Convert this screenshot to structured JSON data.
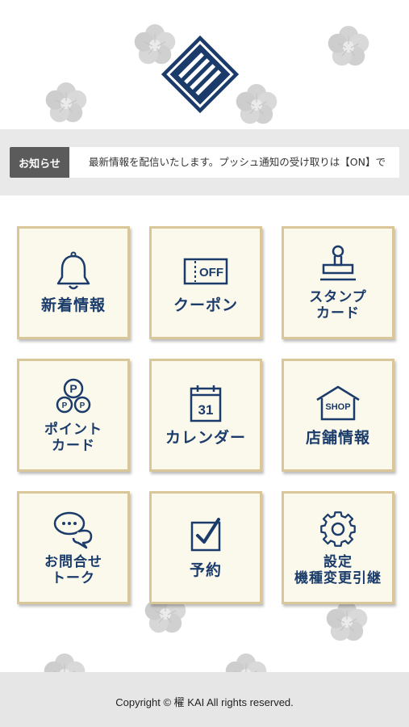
{
  "news": {
    "label": "お知らせ",
    "text": "最新情報を配信いたします。プッシュ通知の受け取りは【ON】で"
  },
  "menu": [
    {
      "label": "新着情報",
      "icon": "bell-icon"
    },
    {
      "label": "クーポン",
      "icon": "coupon-off-icon",
      "icon_text": "OFF"
    },
    {
      "label": "スタンプ\nカード",
      "icon": "stamp-icon"
    },
    {
      "label": "ポイント\nカード",
      "icon": "point-coins-icon",
      "icon_text": "P"
    },
    {
      "label": "カレンダー",
      "icon": "calendar-icon",
      "icon_text": "31"
    },
    {
      "label": "店舗情報",
      "icon": "shop-icon",
      "icon_text": "SHOP"
    },
    {
      "label": "お問合せ\nトーク",
      "icon": "chat-bubbles-icon"
    },
    {
      "label": "予約",
      "icon": "checkbox-icon"
    },
    {
      "label": "設定\n機種変更引継",
      "icon": "gear-icon"
    }
  ],
  "footer": {
    "copyright": "Copyright © 櫂 KAI All rights reserved."
  },
  "colors": {
    "brand_navy": "#1b3c6a",
    "tile_bg": "#fbf8ec",
    "tile_border": "#d9c79a",
    "news_label_bg": "#5b5b5b"
  }
}
